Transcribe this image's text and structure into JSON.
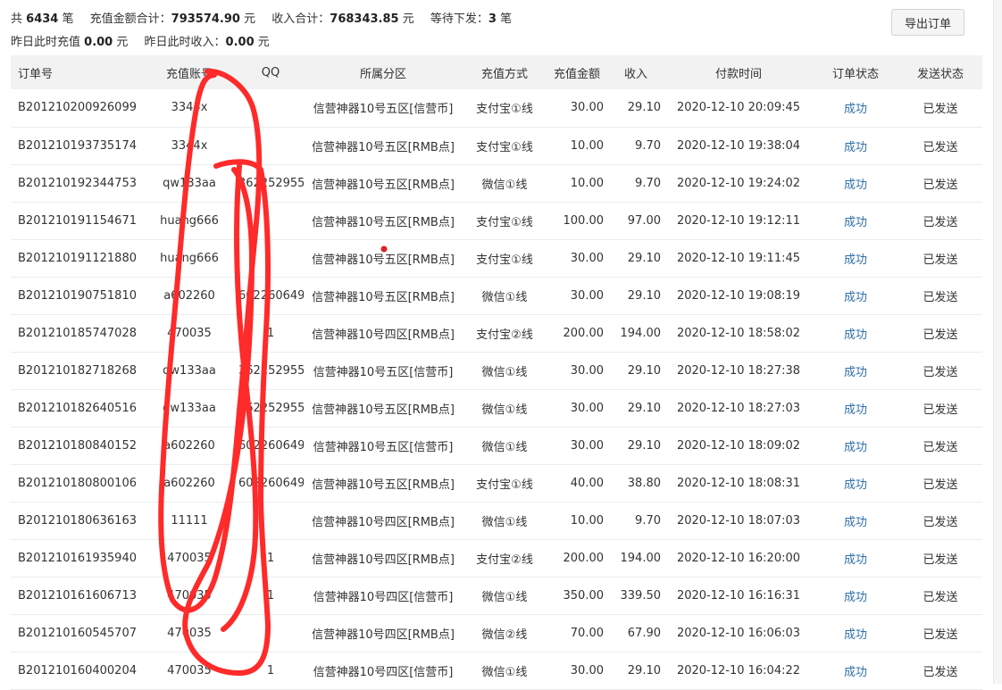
{
  "summary": {
    "total_prefix": "共",
    "total_count": "6434",
    "total_suffix": "笔",
    "recharge_label": "充值金额合计：",
    "recharge_total": "793574.90",
    "recharge_unit": "元",
    "income_label": "收入合计：",
    "income_total": "768343.85",
    "income_unit": "元",
    "pending_label": "等待下发：",
    "pending_count": "3",
    "pending_unit": "笔",
    "yesterday_recharge_label": "昨日此时充值",
    "yesterday_recharge": "0.00",
    "yesterday_recharge_unit": "元",
    "yesterday_income_label": "昨日此时收入：",
    "yesterday_income": "0.00",
    "yesterday_income_unit": "元"
  },
  "toolbar": {
    "export_label": "导出订单"
  },
  "table": {
    "headers": [
      "订单号",
      "充值账号",
      "QQ",
      "所属分区",
      "充值方式",
      "充值金额",
      "收入",
      "付款时间",
      "订单状态",
      "发送状态"
    ],
    "rows": [
      [
        "B201210200926099",
        "3344x",
        "",
        "信营神器10号五区[信营币]",
        "支付宝①线",
        "30.00",
        "29.10",
        "2020-12-10 20:09:45",
        "成功",
        "已发送"
      ],
      [
        "B201210193735174",
        "3344x",
        "",
        "信营神器10号五区[RMB点]",
        "支付宝①线",
        "10.00",
        "9.70",
        "2020-12-10 19:38:04",
        "成功",
        "已发送"
      ],
      [
        "B201210192344753",
        "qw133aa",
        "362252955",
        "信营神器10号五区[RMB点]",
        "微信①线",
        "10.00",
        "9.70",
        "2020-12-10 19:24:02",
        "成功",
        "已发送"
      ],
      [
        "B201210191154671",
        "huang666",
        "",
        "信营神器10号五区[RMB点]",
        "支付宝①线",
        "100.00",
        "97.00",
        "2020-12-10 19:12:11",
        "成功",
        "已发送"
      ],
      [
        "B201210191121880",
        "huang666",
        "",
        "信营神器10号五区[RMB点]",
        "支付宝①线",
        "30.00",
        "29.10",
        "2020-12-10 19:11:45",
        "成功",
        "已发送"
      ],
      [
        "B201210190751810",
        "a602260",
        "602260649",
        "信营神器10号五区[RMB点]",
        "微信①线",
        "30.00",
        "29.10",
        "2020-12-10 19:08:19",
        "成功",
        "已发送"
      ],
      [
        "B201210185747028",
        "470035",
        "1",
        "信营神器10号四区[RMB点]",
        "支付宝②线",
        "200.00",
        "194.00",
        "2020-12-10 18:58:02",
        "成功",
        "已发送"
      ],
      [
        "B201210182718268",
        "qw133aa",
        "362252955",
        "信营神器10号五区[信营币]",
        "微信①线",
        "30.00",
        "29.10",
        "2020-12-10 18:27:38",
        "成功",
        "已发送"
      ],
      [
        "B201210182640516",
        "qw133aa",
        "362252955",
        "信营神器10号五区[RMB点]",
        "微信①线",
        "30.00",
        "29.10",
        "2020-12-10 18:27:03",
        "成功",
        "已发送"
      ],
      [
        "B201210180840152",
        "a602260",
        "602260649",
        "信营神器10号五区[信营币]",
        "微信①线",
        "30.00",
        "29.10",
        "2020-12-10 18:09:02",
        "成功",
        "已发送"
      ],
      [
        "B201210180800106",
        "a602260",
        "602260649",
        "信营神器10号五区[RMB点]",
        "支付宝①线",
        "40.00",
        "38.80",
        "2020-12-10 18:08:31",
        "成功",
        "已发送"
      ],
      [
        "B201210180636163",
        "11111",
        "",
        "信营神器10号四区[RMB点]",
        "微信①线",
        "10.00",
        "9.70",
        "2020-12-10 18:07:03",
        "成功",
        "已发送"
      ],
      [
        "B201210161935940",
        "470035",
        "1",
        "信营神器10号四区[RMB点]",
        "支付宝②线",
        "200.00",
        "194.00",
        "2020-12-10 16:20:00",
        "成功",
        "已发送"
      ],
      [
        "B201210161606713",
        "470035",
        "1",
        "信营神器10号四区[信营币]",
        "微信①线",
        "350.00",
        "339.50",
        "2020-12-10 16:16:31",
        "成功",
        "已发送"
      ],
      [
        "B201210160545707",
        "470035",
        "",
        "信营神器10号四区[RMB点]",
        "微信②线",
        "70.00",
        "67.90",
        "2020-12-10 16:06:03",
        "成功",
        "已发送"
      ],
      [
        "B201210160400204",
        "470035",
        "1",
        "信营神器10号四区[信营币]",
        "微信①线",
        "30.00",
        "29.10",
        "2020-12-10 16:04:22",
        "成功",
        "已发送"
      ]
    ]
  },
  "colors": {
    "status_link": "#2f6fa8",
    "header_bg": "#f2f2f2",
    "annotation": "#ff2a2a"
  }
}
